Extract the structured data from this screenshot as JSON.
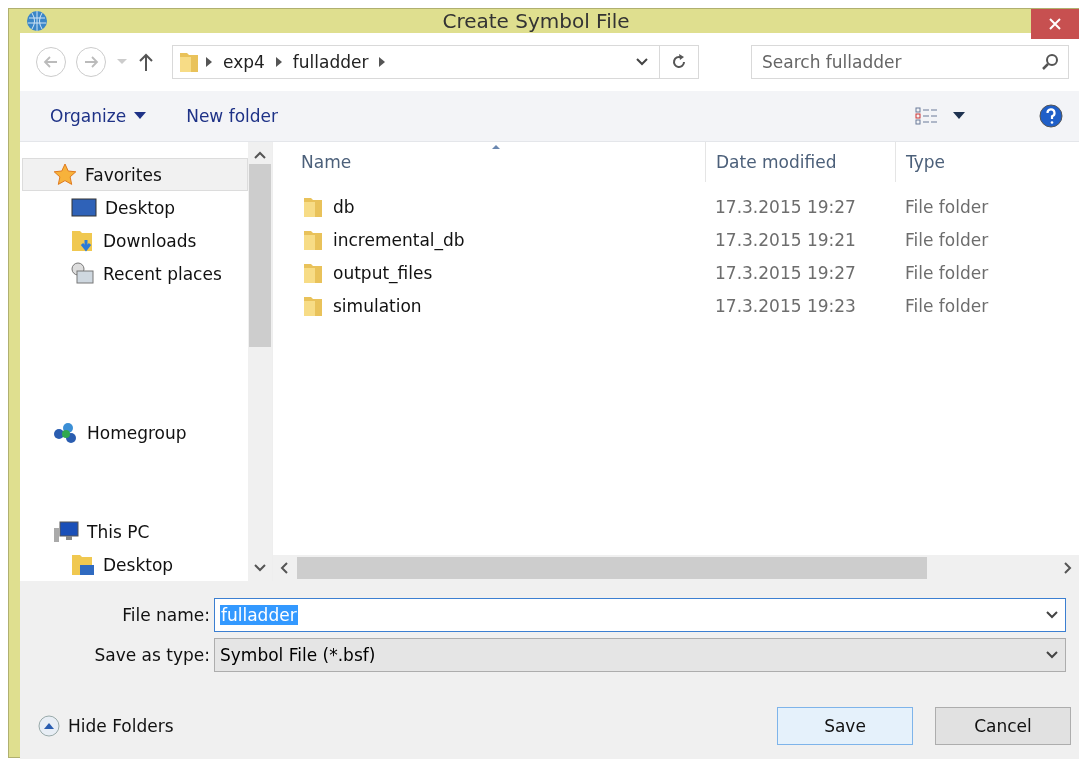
{
  "window": {
    "title": "Create Symbol File"
  },
  "address": {
    "path": [
      "exp4",
      "fulladder"
    ]
  },
  "search": {
    "placeholder": "Search fulladder"
  },
  "toolbar": {
    "organize": "Organize",
    "new_folder": "New folder"
  },
  "sidebar": {
    "items": [
      {
        "label": "Favorites",
        "kind": "star",
        "selected": true,
        "children": [
          {
            "label": "Desktop",
            "kind": "desktop",
            "selected": false
          },
          {
            "label": "Downloads",
            "kind": "downloads",
            "selected": false
          },
          {
            "label": "Recent places",
            "kind": "recent",
            "selected": false
          }
        ]
      },
      {
        "label": "Homegroup",
        "kind": "homegroup",
        "selected": false
      },
      {
        "label": "This PC",
        "kind": "pc",
        "selected": false,
        "children": [
          {
            "label": "Desktop",
            "kind": "folder-desktop",
            "selected": false
          }
        ]
      }
    ]
  },
  "table": {
    "columns": [
      "Name",
      "Date modified",
      "Type"
    ],
    "rows": [
      {
        "name": "db",
        "date": "17.3.2015 19:27",
        "type": "File folder"
      },
      {
        "name": "incremental_db",
        "date": "17.3.2015 19:21",
        "type": "File folder"
      },
      {
        "name": "output_files",
        "date": "17.3.2015 19:27",
        "type": "File folder"
      },
      {
        "name": "simulation",
        "date": "17.3.2015 19:23",
        "type": "File folder"
      }
    ]
  },
  "file_name": {
    "label": "File name:",
    "value": "fulladder",
    "value_selected": true
  },
  "save_as_type": {
    "label": "Save as type:",
    "value": "Symbol File (*.bsf)"
  },
  "hide_folders": "Hide Folders",
  "buttons": [
    {
      "label": "Save",
      "default": true
    },
    {
      "label": "Cancel",
      "default": false
    }
  ]
}
